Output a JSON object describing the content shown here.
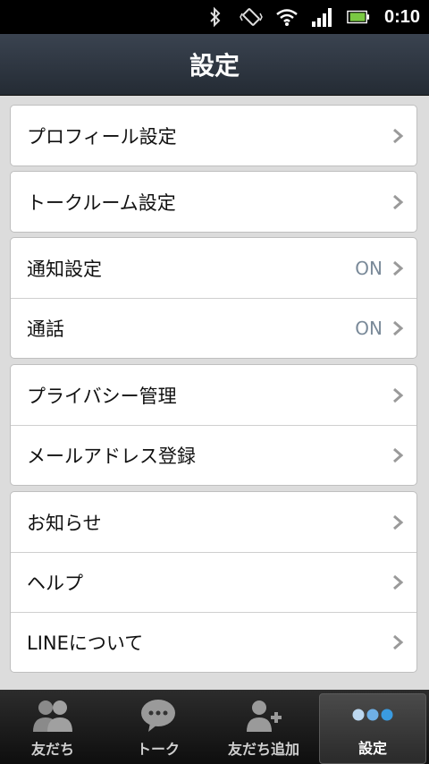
{
  "statusbar": {
    "time": "0:10",
    "icons": [
      "bluetooth-icon",
      "vibrate-icon",
      "wifi-icon",
      "signal-icon",
      "battery-icon"
    ]
  },
  "header": {
    "title": "設定"
  },
  "groups": [
    {
      "items": [
        {
          "label": "プロフィール設定",
          "value": ""
        }
      ]
    },
    {
      "items": [
        {
          "label": "トークルーム設定",
          "value": ""
        }
      ]
    },
    {
      "items": [
        {
          "label": "通知設定",
          "value": "ON"
        },
        {
          "label": "通話",
          "value": "ON"
        }
      ]
    },
    {
      "items": [
        {
          "label": "プライバシー管理",
          "value": ""
        },
        {
          "label": "メールアドレス登録",
          "value": ""
        }
      ]
    },
    {
      "items": [
        {
          "label": "お知らせ",
          "value": ""
        },
        {
          "label": "ヘルプ",
          "value": ""
        },
        {
          "label": "LINEについて",
          "value": ""
        }
      ]
    }
  ],
  "tabs": [
    {
      "label": "友だち",
      "icon": "friends-icon",
      "active": false
    },
    {
      "label": "トーク",
      "icon": "chat-bubble-icon",
      "active": false
    },
    {
      "label": "友だち追加",
      "icon": "add-friend-icon",
      "active": false
    },
    {
      "label": "設定",
      "icon": "more-dots-icon",
      "active": true
    }
  ],
  "colors": {
    "accent_dots": "#3a9be0",
    "header_bg": "#2c333d",
    "value_text": "#7a8a99"
  }
}
